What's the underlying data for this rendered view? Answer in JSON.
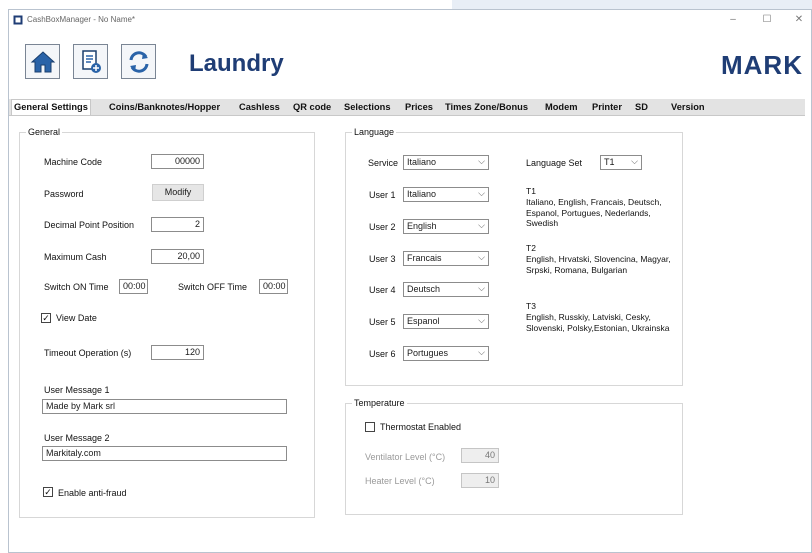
{
  "window": {
    "title": "CashBoxManager - No Name*",
    "controls": {
      "minimize": "–",
      "maximize": "☐",
      "close": "✕"
    }
  },
  "toolbar": {
    "app_title": "Laundry",
    "brand": "MARK"
  },
  "tabs": [
    "General Settings",
    "Coins/Banknotes/Hopper",
    "Cashless",
    "QR code",
    "Selections",
    "Prices",
    "Times Zone/Bonus",
    "Modem",
    "Printer",
    "SD",
    "Version"
  ],
  "general": {
    "title": "General",
    "machine_code_label": "Machine Code",
    "machine_code_value": "00000",
    "password_label": "Password",
    "modify_button": "Modify",
    "decimal_label": "Decimal Point Position",
    "decimal_value": "2",
    "max_cash_label": "Maximum Cash",
    "max_cash_value": "20,00",
    "switch_on_label": "Switch ON Time",
    "switch_on_value": "00:00",
    "switch_off_label": "Switch OFF Time",
    "switch_off_value": "00:00",
    "view_date_label": "View Date",
    "view_date_checked": true,
    "timeout_label": "Timeout Operation (s)",
    "timeout_value": "120",
    "user_message1_label": "User Message 1",
    "user_message1_value": "Made by Mark srl",
    "user_message2_label": "User Message 2",
    "user_message2_value": "Markitaly.com",
    "anti_fraud_label": "Enable anti-fraud",
    "anti_fraud_checked": true
  },
  "language": {
    "title": "Language",
    "service_label": "Service",
    "service_value": "Italiano",
    "users": [
      {
        "label": "User 1",
        "value": "Italiano"
      },
      {
        "label": "User 2",
        "value": "English"
      },
      {
        "label": "User 3",
        "value": "Francais"
      },
      {
        "label": "User 4",
        "value": "Deutsch"
      },
      {
        "label": "User 5",
        "value": "Espanol"
      },
      {
        "label": "User 6",
        "value": "Portugues"
      }
    ],
    "language_set_label": "Language Set",
    "language_set_value": "T1",
    "sets": [
      {
        "name": "T1",
        "text": "Italiano, English, Francais, Deutsch, Espanol, Portugues, Nederlands, Swedish"
      },
      {
        "name": "T2",
        "text": "English, Hrvatski, Slovencina, Magyar, Srpski, Romana, Bulgarian"
      },
      {
        "name": "T3",
        "text": "English, Russkiy, Latviski, Cesky, Slovenski, Polsky,Estonian, Ukrainska"
      }
    ]
  },
  "temperature": {
    "title": "Temperature",
    "thermostat_label": "Thermostat Enabled",
    "thermostat_checked": false,
    "ventilator_label": "Ventilator Level (°C)",
    "ventilator_value": "40",
    "heater_label": "Heater Level (°C)",
    "heater_value": "10"
  }
}
